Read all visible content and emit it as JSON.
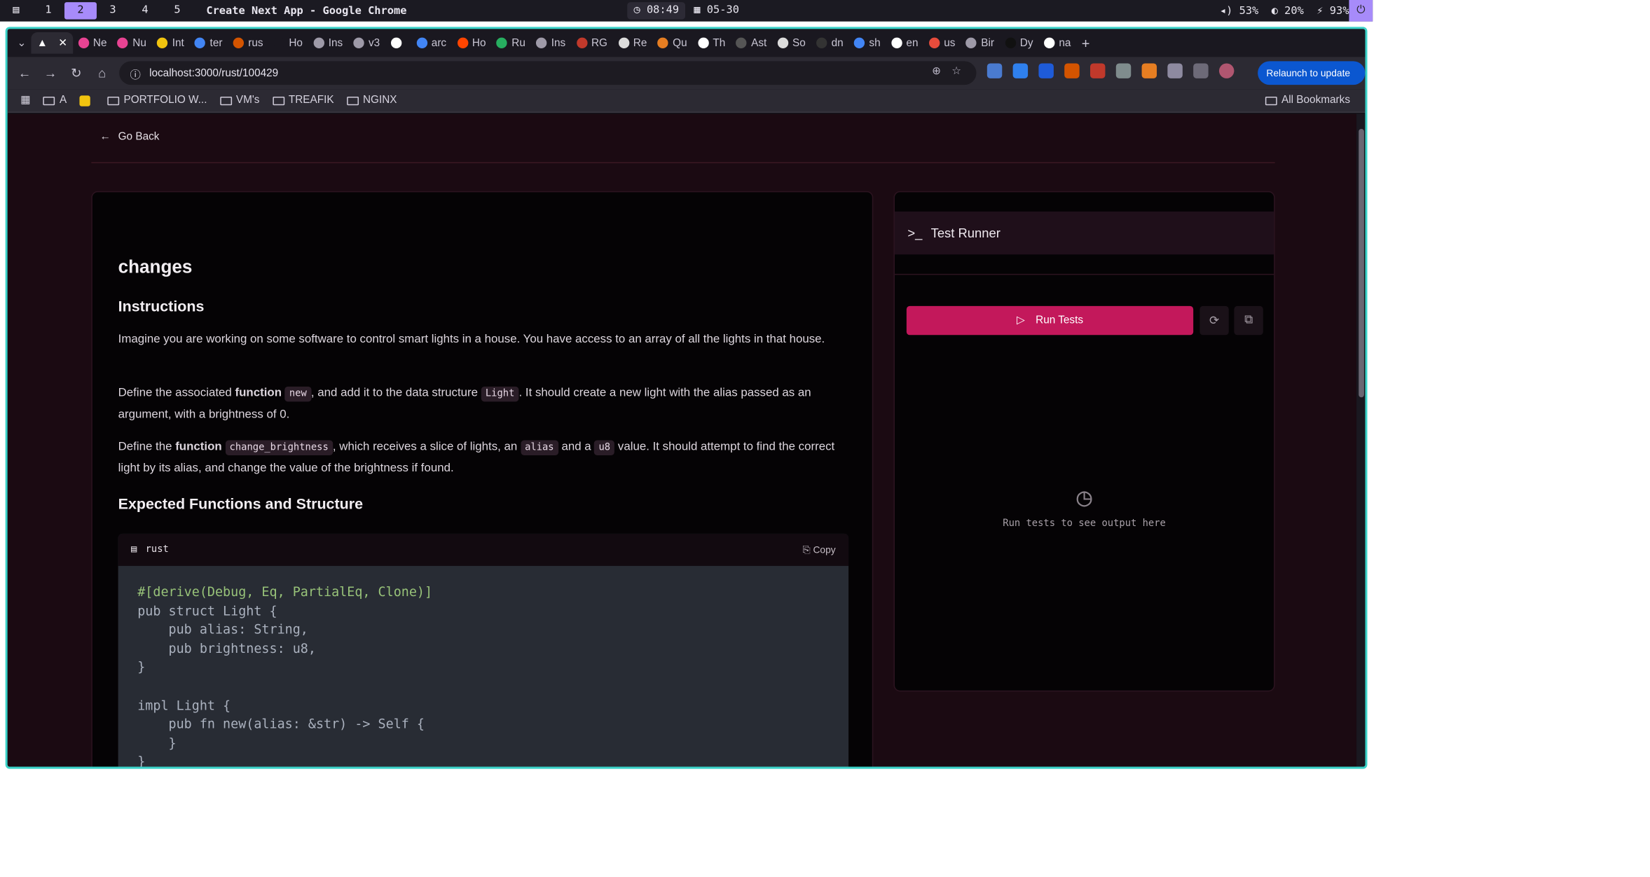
{
  "system_bar": {
    "workspaces": [
      "1",
      "2",
      "3",
      "4",
      "5"
    ],
    "active_workspace": "2",
    "window_title": "Create Next App - Google Chrome",
    "clock": "08:49",
    "date": "05-30",
    "volume": "53%",
    "brightness": "20%",
    "battery": "93%"
  },
  "browser": {
    "tabs": [
      "Ne",
      "Nu",
      "Int",
      "ter",
      "rus",
      "Ho",
      "Ins",
      "v3",
      "",
      "arc",
      "Ho",
      "Ru",
      "Ins",
      "RG",
      "Re",
      "Qu",
      "Th",
      "Ast",
      "So",
      "dn",
      "sh",
      "en",
      "us",
      "Bir",
      "Dy",
      "na"
    ],
    "url": "localhost:3000/rust/100429",
    "relaunch_label": "Relaunch to update",
    "bookmarks": [
      "A",
      "",
      "PORTFOLIO W...",
      "VM's",
      "TREAFIK",
      "NGINX"
    ],
    "all_bookmarks": "All Bookmarks"
  },
  "page": {
    "go_back": "Go Back",
    "exercise_title": "changes",
    "instructions_heading": "Instructions",
    "para1": "Imagine you are working on some software to control smart lights in a house. You have access to an array of all the lights in that house.",
    "para2": {
      "a": "Define the associated ",
      "b": "function",
      "c": "new",
      "d": ", and add it to the data structure ",
      "e": "Light",
      "f": ". It should create a new light with the alias passed as an argument, with a brightness of 0."
    },
    "para3": {
      "a": "Define the ",
      "b": "function",
      "c": "change_brightness",
      "d": ", which receives a slice of lights, an ",
      "e": "alias",
      "f": " and a ",
      "g": "u8",
      "h": " value. It should attempt to find the correct light by its alias, and change the value of the brightness if found."
    },
    "expected_heading": "Expected Functions and Structure",
    "code_lang": "rust",
    "copy_label": "Copy",
    "code_lines": [
      "#[derive(Debug, Eq, PartialEq, Clone)]",
      "pub struct Light {",
      "    pub alias: String,",
      "    pub brightness: u8,",
      "}",
      "",
      "impl Light {",
      "    pub fn new(alias: &str) -> Self {",
      "    }",
      "}"
    ],
    "test_runner_title": "Test Runner",
    "run_tests_label": "Run Tests",
    "empty_output": "Run tests to see output here"
  },
  "colors": {
    "accent": "#c3185b",
    "frame": "#3ad2c8",
    "page_bg": "#1b0a12"
  }
}
